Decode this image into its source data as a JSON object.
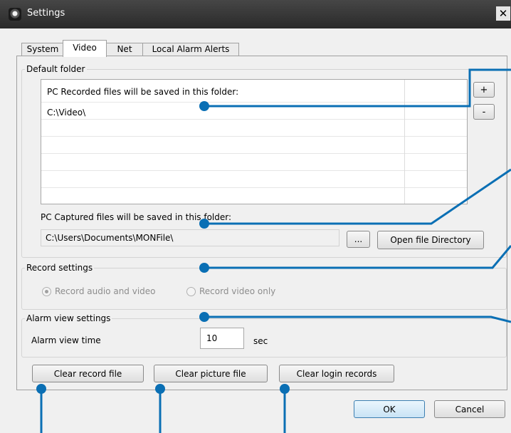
{
  "window": {
    "title": "Settings",
    "close_label": "✕"
  },
  "tabs": [
    {
      "label": "System"
    },
    {
      "label": "Video",
      "active": true
    },
    {
      "label": "Net"
    },
    {
      "label": "Local Alarm Alerts"
    }
  ],
  "default_folder": {
    "legend": "Default folder",
    "list_header": "PC Recorded files will be saved in this folder:",
    "list_value": "C:\\Video\\",
    "add_label": "+",
    "remove_label": "-",
    "captured_label": "PC Captured files will be saved in this folder:",
    "captured_path": "C:\\Users\\Documents\\MONFile\\",
    "browse_label": "...",
    "open_dir_label": "Open file Directory"
  },
  "record_settings": {
    "legend": "Record settings",
    "option_audio_video": "Record audio and video",
    "option_video_only": "Record video only",
    "selected": "audio_video"
  },
  "alarm_view": {
    "legend": "Alarm view settings",
    "time_label": "Alarm view time",
    "time_value": "10",
    "unit": "sec"
  },
  "buttons": {
    "clear_record": "Clear record file",
    "clear_picture": "Clear picture file",
    "clear_login": "Clear login records",
    "ok": "OK",
    "cancel": "Cancel"
  },
  "colors": {
    "callout": "#0a6fb4",
    "titlebar": "#333333",
    "accent_border": "#3c7fb1"
  }
}
